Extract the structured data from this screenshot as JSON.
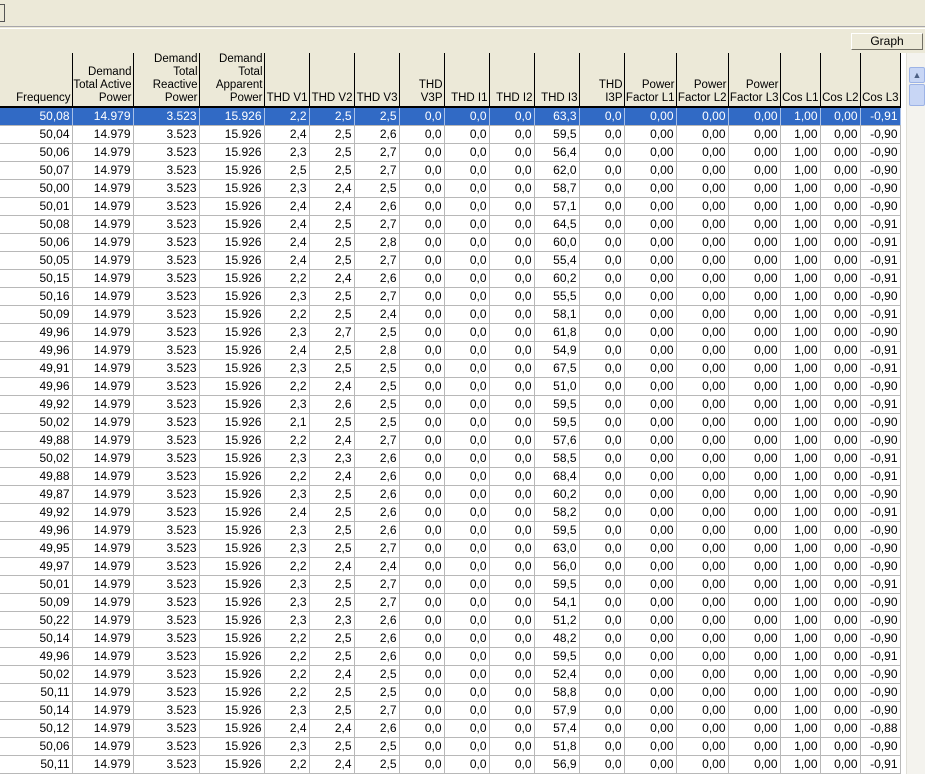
{
  "toolbar": {
    "graph_label": "Graph"
  },
  "table": {
    "columns": [
      "Frequency",
      "Demand Total Active Power",
      "Demand Total Reactive Power",
      "Demand Total Apparent Power",
      "THD V1",
      "THD V2",
      "THD V3",
      "THD V3P",
      "THD I1",
      "THD I2",
      "THD I3",
      "THD I3P",
      "Power Factor L1",
      "Power Factor L2",
      "Power Factor L3",
      "Cos L1",
      "Cos L2",
      "Cos L3"
    ],
    "selected_row": 0,
    "rows": [
      [
        "50,08",
        "14.979",
        "3.523",
        "15.926",
        "2,2",
        "2,5",
        "2,5",
        "0,0",
        "0,0",
        "0,0",
        "63,3",
        "0,0",
        "0,00",
        "0,00",
        "0,00",
        "1,00",
        "0,00",
        "-0,91"
      ],
      [
        "50,04",
        "14.979",
        "3.523",
        "15.926",
        "2,4",
        "2,5",
        "2,6",
        "0,0",
        "0,0",
        "0,0",
        "59,5",
        "0,0",
        "0,00",
        "0,00",
        "0,00",
        "1,00",
        "0,00",
        "-0,90"
      ],
      [
        "50,06",
        "14.979",
        "3.523",
        "15.926",
        "2,3",
        "2,5",
        "2,7",
        "0,0",
        "0,0",
        "0,0",
        "56,4",
        "0,0",
        "0,00",
        "0,00",
        "0,00",
        "1,00",
        "0,00",
        "-0,90"
      ],
      [
        "50,07",
        "14.979",
        "3.523",
        "15.926",
        "2,5",
        "2,5",
        "2,7",
        "0,0",
        "0,0",
        "0,0",
        "62,0",
        "0,0",
        "0,00",
        "0,00",
        "0,00",
        "1,00",
        "0,00",
        "-0,90"
      ],
      [
        "50,00",
        "14.979",
        "3.523",
        "15.926",
        "2,3",
        "2,4",
        "2,5",
        "0,0",
        "0,0",
        "0,0",
        "58,7",
        "0,0",
        "0,00",
        "0,00",
        "0,00",
        "1,00",
        "0,00",
        "-0,90"
      ],
      [
        "50,01",
        "14.979",
        "3.523",
        "15.926",
        "2,4",
        "2,4",
        "2,6",
        "0,0",
        "0,0",
        "0,0",
        "57,1",
        "0,0",
        "0,00",
        "0,00",
        "0,00",
        "1,00",
        "0,00",
        "-0,90"
      ],
      [
        "50,08",
        "14.979",
        "3.523",
        "15.926",
        "2,4",
        "2,5",
        "2,7",
        "0,0",
        "0,0",
        "0,0",
        "64,5",
        "0,0",
        "0,00",
        "0,00",
        "0,00",
        "1,00",
        "0,00",
        "-0,91"
      ],
      [
        "50,06",
        "14.979",
        "3.523",
        "15.926",
        "2,4",
        "2,5",
        "2,8",
        "0,0",
        "0,0",
        "0,0",
        "60,0",
        "0,0",
        "0,00",
        "0,00",
        "0,00",
        "1,00",
        "0,00",
        "-0,91"
      ],
      [
        "50,05",
        "14.979",
        "3.523",
        "15.926",
        "2,4",
        "2,5",
        "2,7",
        "0,0",
        "0,0",
        "0,0",
        "55,4",
        "0,0",
        "0,00",
        "0,00",
        "0,00",
        "1,00",
        "0,00",
        "-0,91"
      ],
      [
        "50,15",
        "14.979",
        "3.523",
        "15.926",
        "2,2",
        "2,4",
        "2,6",
        "0,0",
        "0,0",
        "0,0",
        "60,2",
        "0,0",
        "0,00",
        "0,00",
        "0,00",
        "1,00",
        "0,00",
        "-0,91"
      ],
      [
        "50,16",
        "14.979",
        "3.523",
        "15.926",
        "2,3",
        "2,5",
        "2,7",
        "0,0",
        "0,0",
        "0,0",
        "55,5",
        "0,0",
        "0,00",
        "0,00",
        "0,00",
        "1,00",
        "0,00",
        "-0,90"
      ],
      [
        "50,09",
        "14.979",
        "3.523",
        "15.926",
        "2,2",
        "2,5",
        "2,4",
        "0,0",
        "0,0",
        "0,0",
        "58,1",
        "0,0",
        "0,00",
        "0,00",
        "0,00",
        "1,00",
        "0,00",
        "-0,91"
      ],
      [
        "49,96",
        "14.979",
        "3.523",
        "15.926",
        "2,3",
        "2,7",
        "2,5",
        "0,0",
        "0,0",
        "0,0",
        "61,8",
        "0,0",
        "0,00",
        "0,00",
        "0,00",
        "1,00",
        "0,00",
        "-0,90"
      ],
      [
        "49,96",
        "14.979",
        "3.523",
        "15.926",
        "2,4",
        "2,5",
        "2,8",
        "0,0",
        "0,0",
        "0,0",
        "54,9",
        "0,0",
        "0,00",
        "0,00",
        "0,00",
        "1,00",
        "0,00",
        "-0,91"
      ],
      [
        "49,91",
        "14.979",
        "3.523",
        "15.926",
        "2,3",
        "2,5",
        "2,5",
        "0,0",
        "0,0",
        "0,0",
        "67,5",
        "0,0",
        "0,00",
        "0,00",
        "0,00",
        "1,00",
        "0,00",
        "-0,91"
      ],
      [
        "49,96",
        "14.979",
        "3.523",
        "15.926",
        "2,2",
        "2,4",
        "2,5",
        "0,0",
        "0,0",
        "0,0",
        "51,0",
        "0,0",
        "0,00",
        "0,00",
        "0,00",
        "1,00",
        "0,00",
        "-0,90"
      ],
      [
        "49,92",
        "14.979",
        "3.523",
        "15.926",
        "2,3",
        "2,6",
        "2,5",
        "0,0",
        "0,0",
        "0,0",
        "59,5",
        "0,0",
        "0,00",
        "0,00",
        "0,00",
        "1,00",
        "0,00",
        "-0,91"
      ],
      [
        "50,02",
        "14.979",
        "3.523",
        "15.926",
        "2,1",
        "2,5",
        "2,5",
        "0,0",
        "0,0",
        "0,0",
        "59,5",
        "0,0",
        "0,00",
        "0,00",
        "0,00",
        "1,00",
        "0,00",
        "-0,90"
      ],
      [
        "49,88",
        "14.979",
        "3.523",
        "15.926",
        "2,2",
        "2,4",
        "2,7",
        "0,0",
        "0,0",
        "0,0",
        "57,6",
        "0,0",
        "0,00",
        "0,00",
        "0,00",
        "1,00",
        "0,00",
        "-0,90"
      ],
      [
        "50,02",
        "14.979",
        "3.523",
        "15.926",
        "2,3",
        "2,3",
        "2,6",
        "0,0",
        "0,0",
        "0,0",
        "58,5",
        "0,0",
        "0,00",
        "0,00",
        "0,00",
        "1,00",
        "0,00",
        "-0,91"
      ],
      [
        "49,88",
        "14.979",
        "3.523",
        "15.926",
        "2,2",
        "2,4",
        "2,6",
        "0,0",
        "0,0",
        "0,0",
        "68,4",
        "0,0",
        "0,00",
        "0,00",
        "0,00",
        "1,00",
        "0,00",
        "-0,91"
      ],
      [
        "49,87",
        "14.979",
        "3.523",
        "15.926",
        "2,3",
        "2,5",
        "2,6",
        "0,0",
        "0,0",
        "0,0",
        "60,2",
        "0,0",
        "0,00",
        "0,00",
        "0,00",
        "1,00",
        "0,00",
        "-0,90"
      ],
      [
        "49,92",
        "14.979",
        "3.523",
        "15.926",
        "2,4",
        "2,5",
        "2,6",
        "0,0",
        "0,0",
        "0,0",
        "58,2",
        "0,0",
        "0,00",
        "0,00",
        "0,00",
        "1,00",
        "0,00",
        "-0,91"
      ],
      [
        "49,96",
        "14.979",
        "3.523",
        "15.926",
        "2,3",
        "2,5",
        "2,6",
        "0,0",
        "0,0",
        "0,0",
        "59,5",
        "0,0",
        "0,00",
        "0,00",
        "0,00",
        "1,00",
        "0,00",
        "-0,90"
      ],
      [
        "49,95",
        "14.979",
        "3.523",
        "15.926",
        "2,3",
        "2,5",
        "2,7",
        "0,0",
        "0,0",
        "0,0",
        "63,0",
        "0,0",
        "0,00",
        "0,00",
        "0,00",
        "1,00",
        "0,00",
        "-0,90"
      ],
      [
        "49,97",
        "14.979",
        "3.523",
        "15.926",
        "2,2",
        "2,4",
        "2,4",
        "0,0",
        "0,0",
        "0,0",
        "56,0",
        "0,0",
        "0,00",
        "0,00",
        "0,00",
        "1,00",
        "0,00",
        "-0,90"
      ],
      [
        "50,01",
        "14.979",
        "3.523",
        "15.926",
        "2,3",
        "2,5",
        "2,7",
        "0,0",
        "0,0",
        "0,0",
        "59,5",
        "0,0",
        "0,00",
        "0,00",
        "0,00",
        "1,00",
        "0,00",
        "-0,91"
      ],
      [
        "50,09",
        "14.979",
        "3.523",
        "15.926",
        "2,3",
        "2,5",
        "2,7",
        "0,0",
        "0,0",
        "0,0",
        "54,1",
        "0,0",
        "0,00",
        "0,00",
        "0,00",
        "1,00",
        "0,00",
        "-0,90"
      ],
      [
        "50,22",
        "14.979",
        "3.523",
        "15.926",
        "2,3",
        "2,3",
        "2,6",
        "0,0",
        "0,0",
        "0,0",
        "51,2",
        "0,0",
        "0,00",
        "0,00",
        "0,00",
        "1,00",
        "0,00",
        "-0,90"
      ],
      [
        "50,14",
        "14.979",
        "3.523",
        "15.926",
        "2,2",
        "2,5",
        "2,6",
        "0,0",
        "0,0",
        "0,0",
        "48,2",
        "0,0",
        "0,00",
        "0,00",
        "0,00",
        "1,00",
        "0,00",
        "-0,90"
      ],
      [
        "49,96",
        "14.979",
        "3.523",
        "15.926",
        "2,2",
        "2,5",
        "2,6",
        "0,0",
        "0,0",
        "0,0",
        "59,5",
        "0,0",
        "0,00",
        "0,00",
        "0,00",
        "1,00",
        "0,00",
        "-0,91"
      ],
      [
        "50,02",
        "14.979",
        "3.523",
        "15.926",
        "2,2",
        "2,4",
        "2,5",
        "0,0",
        "0,0",
        "0,0",
        "52,4",
        "0,0",
        "0,00",
        "0,00",
        "0,00",
        "1,00",
        "0,00",
        "-0,90"
      ],
      [
        "50,11",
        "14.979",
        "3.523",
        "15.926",
        "2,2",
        "2,5",
        "2,5",
        "0,0",
        "0,0",
        "0,0",
        "58,8",
        "0,0",
        "0,00",
        "0,00",
        "0,00",
        "1,00",
        "0,00",
        "-0,90"
      ],
      [
        "50,14",
        "14.979",
        "3.523",
        "15.926",
        "2,3",
        "2,5",
        "2,7",
        "0,0",
        "0,0",
        "0,0",
        "57,9",
        "0,0",
        "0,00",
        "0,00",
        "0,00",
        "1,00",
        "0,00",
        "-0,90"
      ],
      [
        "50,12",
        "14.979",
        "3.523",
        "15.926",
        "2,4",
        "2,4",
        "2,6",
        "0,0",
        "0,0",
        "0,0",
        "57,4",
        "0,0",
        "0,00",
        "0,00",
        "0,00",
        "1,00",
        "0,00",
        "-0,88"
      ],
      [
        "50,06",
        "14.979",
        "3.523",
        "15.926",
        "2,3",
        "2,5",
        "2,5",
        "0,0",
        "0,0",
        "0,0",
        "51,8",
        "0,0",
        "0,00",
        "0,00",
        "0,00",
        "1,00",
        "0,00",
        "-0,90"
      ],
      [
        "50,11",
        "14.979",
        "3.523",
        "15.926",
        "2,2",
        "2,4",
        "2,5",
        "0,0",
        "0,0",
        "0,0",
        "56,9",
        "0,0",
        "0,00",
        "0,00",
        "0,00",
        "1,00",
        "0,00",
        "-0,91"
      ]
    ]
  },
  "colors": {
    "selection": "#316ac5",
    "window": "#ece9d8"
  }
}
